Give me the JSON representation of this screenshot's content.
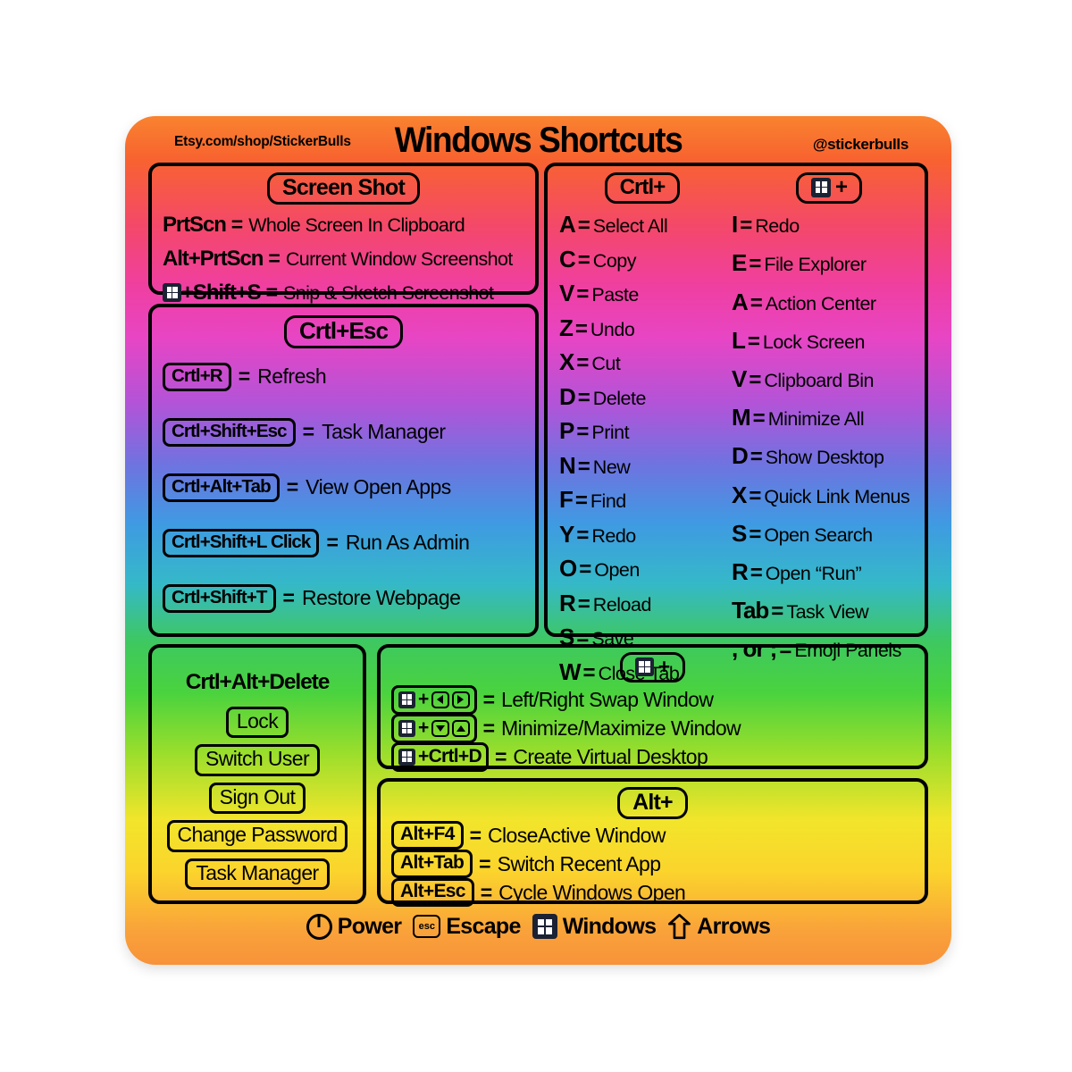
{
  "header": {
    "shop_url": "Etsy.com/shop/StickerBulls",
    "title": "Windows Shortcuts",
    "handle": "@stickerbulls"
  },
  "screenshot_section": {
    "heading": "Screen Shot",
    "rows": [
      {
        "key": "PrtScn",
        "eq": "=",
        "value": "Whole Screen In Clipboard",
        "icon": ""
      },
      {
        "key": "Alt+PrtScn",
        "eq": "=",
        "value": "Current Window Screenshot",
        "icon": ""
      },
      {
        "key": "+Shift+S",
        "eq": "=",
        "value": "Snip & Sketch Screenshot",
        "icon": "windows-logo-icon"
      }
    ]
  },
  "ctrl_esc_section": {
    "heading": "Crtl+Esc",
    "rows": [
      {
        "chip": "Crtl+R",
        "eq": "=",
        "value": "Refresh"
      },
      {
        "chip": "Crtl+Shift+Esc",
        "eq": "=",
        "value": "Task Manager"
      },
      {
        "chip": "Crtl+Alt+Tab",
        "eq": "=",
        "value": "View Open Apps"
      },
      {
        "chip": "Crtl+Shift+L Click",
        "eq": "=",
        "value": "Run As Admin"
      },
      {
        "chip": "Crtl+Shift+T",
        "eq": "=",
        "value": "Restore Webpage"
      }
    ]
  },
  "ctrl_column": {
    "heading": "Crtl+",
    "rows": [
      {
        "key": "A",
        "eq": "=",
        "value": "Select All"
      },
      {
        "key": "C",
        "eq": "=",
        "value": "Copy"
      },
      {
        "key": "V",
        "eq": "=",
        "value": "Paste"
      },
      {
        "key": "Z",
        "eq": "=",
        "value": "Undo"
      },
      {
        "key": "X",
        "eq": "=",
        "value": "Cut"
      },
      {
        "key": "D",
        "eq": "=",
        "value": "Delete"
      },
      {
        "key": "P",
        "eq": "=",
        "value": "Print"
      },
      {
        "key": "N",
        "eq": "=",
        "value": "New"
      },
      {
        "key": "F",
        "eq": "=",
        "value": "Find"
      },
      {
        "key": "Y",
        "eq": "=",
        "value": "Redo"
      },
      {
        "key": "O",
        "eq": "=",
        "value": "Open"
      },
      {
        "key": "R",
        "eq": "=",
        "value": "Reload"
      },
      {
        "key": "S",
        "eq": "=",
        "value": "Save"
      },
      {
        "key": "W",
        "eq": "=",
        "value": "Close Tab"
      }
    ]
  },
  "win_column": {
    "heading_icon": "windows-logo-icon",
    "heading_plus": "+",
    "rows": [
      {
        "key": "I",
        "eq": "=",
        "value": "Redo"
      },
      {
        "key": "E",
        "eq": "=",
        "value": "File Explorer"
      },
      {
        "key": "A",
        "eq": "=",
        "value": "Action Center"
      },
      {
        "key": "L",
        "eq": "=",
        "value": "Lock Screen"
      },
      {
        "key": "V",
        "eq": "=",
        "value": "Clipboard Bin"
      },
      {
        "key": "M",
        "eq": "=",
        "value": "Minimize All"
      },
      {
        "key": "D",
        "eq": "=",
        "value": "Show Desktop"
      },
      {
        "key": "X",
        "eq": "=",
        "value": "Quick Link Menus"
      },
      {
        "key": "S",
        "eq": "=",
        "value": "Open Search"
      },
      {
        "key": "R",
        "eq": "=",
        "value": "Open “Run”"
      },
      {
        "key": "Tab",
        "eq": "=",
        "value": "Task View"
      },
      {
        "key": ", or ;",
        "eq": "=",
        "value": "Emoji Panels"
      }
    ]
  },
  "ctrl_alt_delete_section": {
    "title": "Crtl+Alt+Delete",
    "options": [
      "Lock",
      "Switch User",
      "Sign Out",
      "Change Password",
      "Task Manager"
    ]
  },
  "win_bottom_section": {
    "heading_icon": "windows-logo-icon",
    "heading_plus": "+",
    "rows": [
      {
        "chip_text": "+",
        "arrows": [
          "left",
          "right"
        ],
        "eq": "=",
        "value": "Left/Right Swap Window"
      },
      {
        "chip_text": "+",
        "arrows": [
          "down",
          "up"
        ],
        "eq": "=",
        "value": "Minimize/Maximize Window"
      },
      {
        "chip_text": "+Crtl+D",
        "arrows": [],
        "eq": "=",
        "value": "Create Virtual Desktop"
      }
    ]
  },
  "alt_section": {
    "heading": "Alt+",
    "rows": [
      {
        "chip": "Alt+F4",
        "eq": "=",
        "value": "CloseActive Window"
      },
      {
        "chip": "Alt+Tab",
        "eq": "=",
        "value": "Switch Recent App"
      },
      {
        "chip": "Alt+Esc",
        "eq": "=",
        "value": "Cycle Windows Open"
      }
    ]
  },
  "legend": [
    {
      "icon": "power-icon",
      "label": "Power"
    },
    {
      "icon": "escape-key-icon",
      "icon_text": "esc",
      "label": "Escape"
    },
    {
      "icon": "windows-logo-icon",
      "label": "Windows"
    },
    {
      "icon": "up-arrow-icon",
      "label": "Arrows"
    }
  ],
  "colors": {
    "ink": "#000000",
    "win_logo_bg": "#1b2233",
    "gradient_stops": [
      "#f9832f",
      "#ef3fa0",
      "#b154d8",
      "#3f9ae2",
      "#3ec85f",
      "#f2e52b",
      "#f8923a"
    ]
  }
}
